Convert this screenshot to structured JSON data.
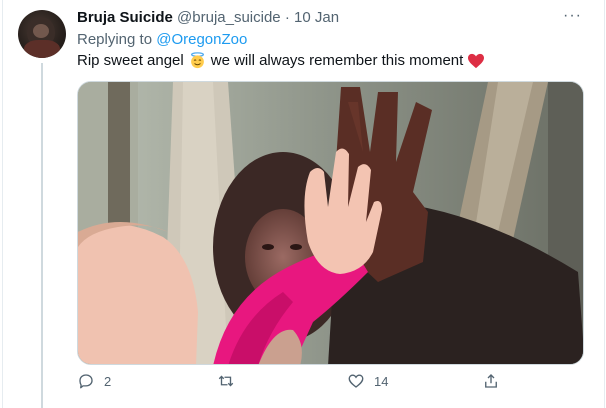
{
  "tweet": {
    "author_name": "Bruja Suicide",
    "author_handle": "@bruja_suicide",
    "separator": "·",
    "date": "10 Jan",
    "replying_label": "Replying to",
    "replying_to": "@OregonZoo",
    "text_before": "Rip sweet angel",
    "text_after": "we will always remember this moment",
    "emoji_angel": "smiling-face-with-halo",
    "emoji_heart": "red-heart",
    "more_icon": "···"
  },
  "actions": {
    "reply_count": "2",
    "retweet_count": "",
    "like_count": "14",
    "share_count": ""
  },
  "colors": {
    "text": "#0f1419",
    "secondary": "#536471",
    "link": "#1d9bf0",
    "heart": "#e0245e",
    "thread_line": "#cfd9de"
  }
}
